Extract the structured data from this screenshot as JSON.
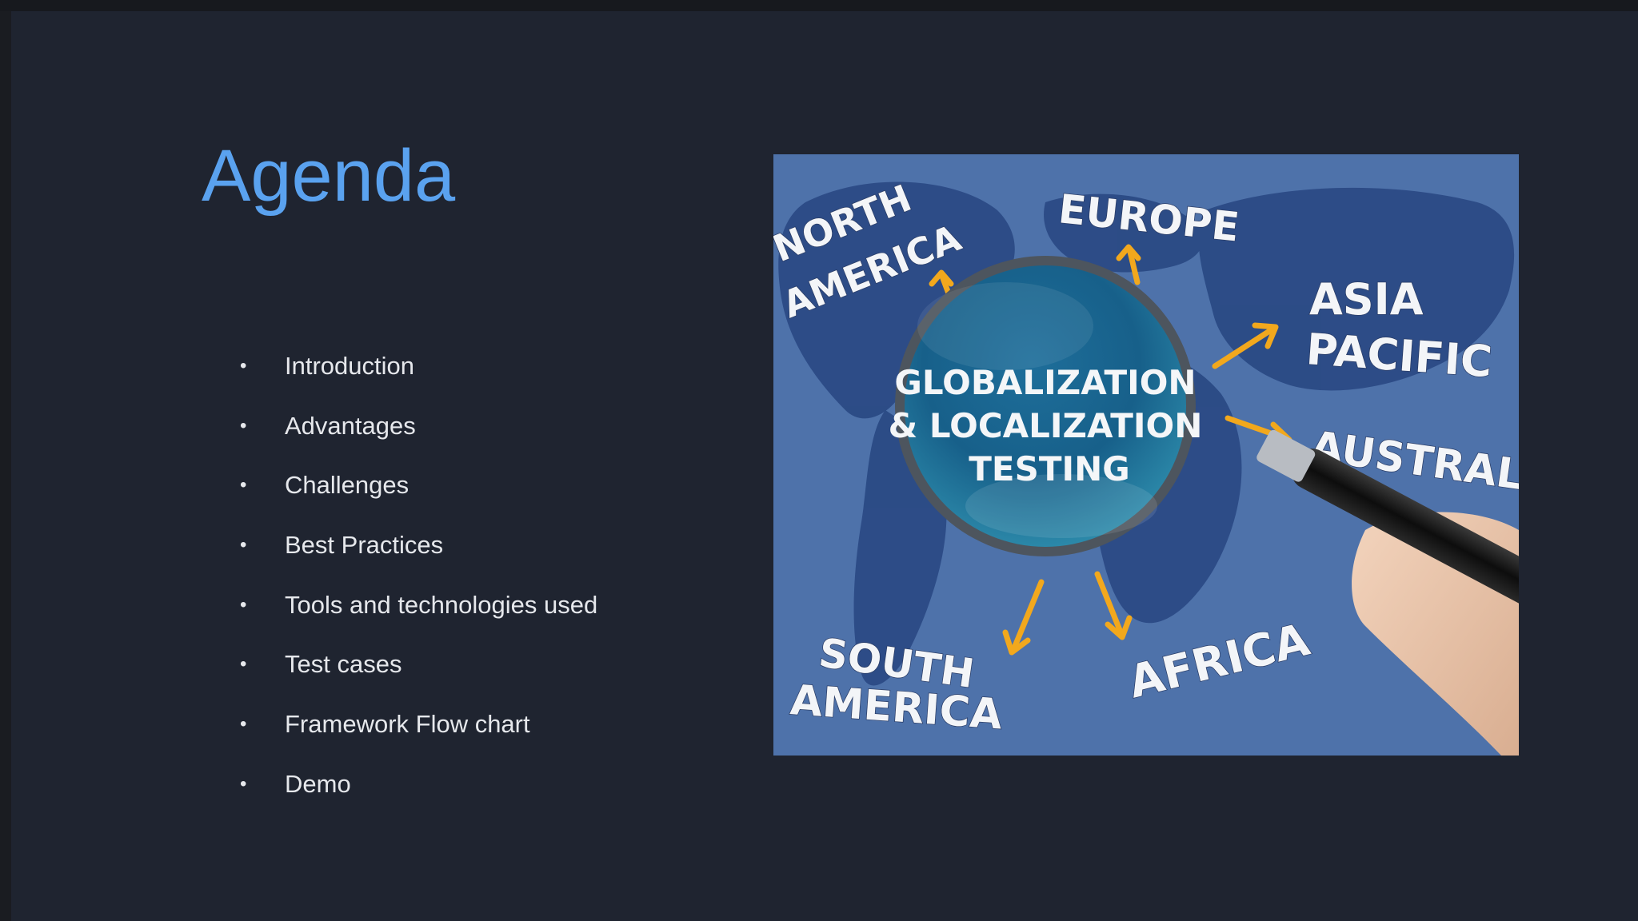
{
  "slide": {
    "title": "Agenda",
    "agenda_items": [
      "Introduction",
      "Advantages",
      "Challenges",
      "Best Practices",
      "Tools and technologies used",
      "Test cases",
      "Framework Flow chart",
      "Demo"
    ],
    "bullet_glyph": "•"
  },
  "image": {
    "icon": "globe-magnifier-illustration",
    "center_text": [
      "GLOBALIZATION",
      "& LOCALIZATION",
      "TESTING"
    ],
    "regions": {
      "north_america": [
        "NORTH",
        "AMERICA"
      ],
      "europe": "EUROPE",
      "asia_pacific": [
        "ASIA",
        "PACIFIC"
      ],
      "australia": "AUSTRAL",
      "south_america": [
        "SOUTH",
        "AMERICA"
      ],
      "africa": "AFRICA"
    }
  },
  "colors": {
    "background": "#1f2430",
    "title": "#5aa2ef",
    "text": "#e6e8ec",
    "map_ocean": "#4c6fa8",
    "map_land": "#2c4a86",
    "arrow": "#f2a81d"
  }
}
